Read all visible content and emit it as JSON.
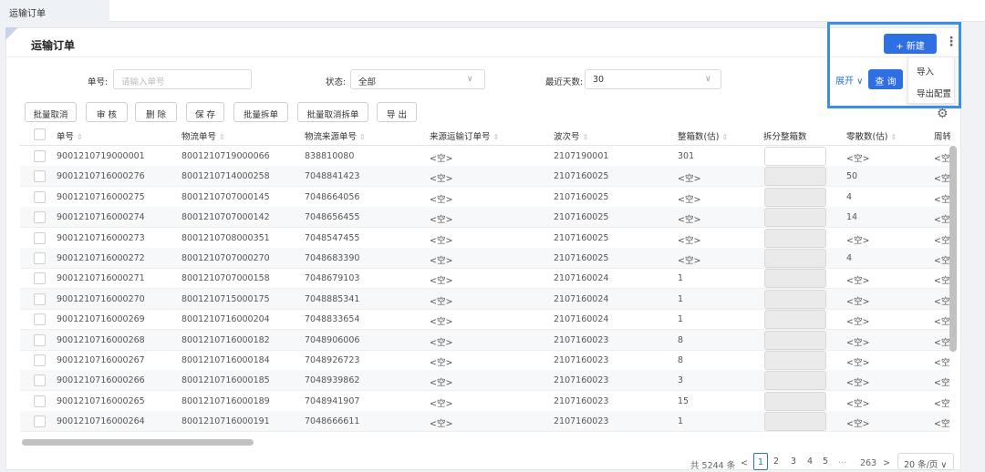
{
  "top_tab": "运输订单",
  "title": "运输订单",
  "filters": {
    "order_no_label": "单号:",
    "order_no_placeholder": "请输入单号",
    "status_label": "状态:",
    "status_value": "全部",
    "recent_days_label": "最近天数:",
    "recent_days_value": "30"
  },
  "actions": {
    "new": "+ 新建",
    "expand": "展开 ∨",
    "query": "查 询"
  },
  "menu": [
    "导入",
    "导出配置"
  ],
  "toolbar": [
    "批量取消",
    "审 核",
    "删 除",
    "保 存",
    "批量拆单",
    "批量取消拆单",
    "导 出"
  ],
  "columns": [
    "单号",
    "物流单号",
    "物流来源单号",
    "来源运输订单号",
    "波次号",
    "整箱数(估)",
    "拆分整箱数",
    "零散数(估)",
    "周转"
  ],
  "rows": [
    [
      "9001210719000001",
      "8001210719000066",
      "838810080",
      "<空>",
      "2107190001",
      "301",
      "<空>",
      "<空"
    ],
    [
      "9001210716000276",
      "8001210714000258",
      "7048841423",
      "<空>",
      "2107160025",
      "<空>",
      "50",
      "<空"
    ],
    [
      "9001210716000275",
      "8001210707000145",
      "7048664056",
      "<空>",
      "2107160025",
      "<空>",
      "4",
      "<空"
    ],
    [
      "9001210716000274",
      "8001210707000142",
      "7048656455",
      "<空>",
      "2107160025",
      "<空>",
      "14",
      "<空"
    ],
    [
      "9001210716000273",
      "8001210708000351",
      "7048547455",
      "<空>",
      "2107160025",
      "<空>",
      "<空>",
      "<空"
    ],
    [
      "9001210716000272",
      "8001210707000270",
      "7048683390",
      "<空>",
      "2107160025",
      "<空>",
      "4",
      "<空"
    ],
    [
      "9001210716000271",
      "8001210707000158",
      "7048679103",
      "<空>",
      "2107160024",
      "1",
      "<空>",
      "<空"
    ],
    [
      "9001210716000270",
      "8001210715000175",
      "7048885341",
      "<空>",
      "2107160024",
      "1",
      "<空>",
      "<空"
    ],
    [
      "9001210716000269",
      "8001210716000204",
      "7048833654",
      "<空>",
      "2107160024",
      "1",
      "<空>",
      "<空"
    ],
    [
      "9001210716000268",
      "8001210716000182",
      "7048906006",
      "<空>",
      "2107160023",
      "8",
      "<空>",
      "<空"
    ],
    [
      "9001210716000267",
      "8001210716000184",
      "7048926723",
      "<空>",
      "2107160023",
      "8",
      "<空>",
      "<空"
    ],
    [
      "9001210716000266",
      "8001210716000185",
      "7048939862",
      "<空>",
      "2107160023",
      "3",
      "<空>",
      "<空"
    ],
    [
      "9001210716000265",
      "8001210716000189",
      "7048941907",
      "<空>",
      "2107160023",
      "15",
      "<空>",
      "<空"
    ],
    [
      "9001210716000264",
      "8001210716000191",
      "7048666611",
      "<空>",
      "2107160023",
      "1",
      "<空>",
      "<空"
    ]
  ],
  "pagination": {
    "total": "共 5244 条",
    "prev": "<",
    "pages": [
      "1",
      "2",
      "3",
      "4",
      "5"
    ],
    "ellipsis": "···",
    "last": "263",
    "next": ">",
    "page_size": "20 条/页 ∨"
  },
  "colors": {
    "primary": "#2f6fe4",
    "highlight": "#3b8fe6"
  },
  "icons": {
    "sort": "sort-icon",
    "settings": "gear-icon",
    "more": "kebab-icon"
  }
}
